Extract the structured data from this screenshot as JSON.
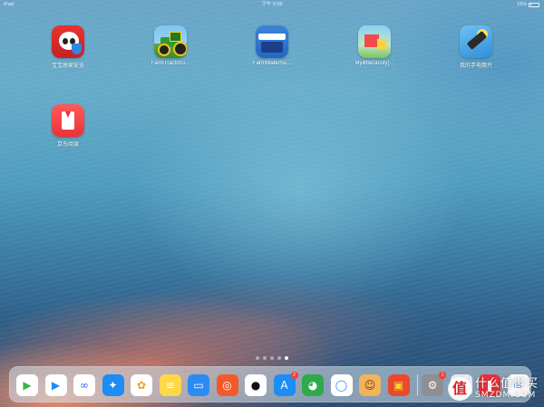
{
  "status_bar": {
    "device": "iPad",
    "time": "下午 5:09",
    "battery_text": "15%",
    "battery_level": 0.15
  },
  "home_apps": [
    {
      "label": "宝宝居家安全",
      "icon": "panda-safety-icon"
    },
    {
      "label": "FarmTractorG...",
      "icon": "tractor-icon"
    },
    {
      "label": "FarmWaterSu...",
      "icon": "water-truck-icon"
    },
    {
      "label": "Mylittlecarcity(...",
      "icon": "toy-city-icon"
    },
    {
      "label": "我的手电筒只",
      "icon": "flashlight-icon"
    },
    {
      "label": "京东阅读",
      "icon": "bookmark-icon"
    }
  ],
  "page_indicator": {
    "count": 5,
    "active_index": 4
  },
  "dock": {
    "apps": [
      {
        "name": "video-player-icon",
        "color": "#ffffff",
        "glyph": "▶",
        "glyph_color": "#3ab54a"
      },
      {
        "name": "video-app-icon",
        "color": "#ffffff",
        "glyph": "▶",
        "glyph_color": "#1c8cf0"
      },
      {
        "name": "cloud-drive-icon",
        "color": "#ffffff",
        "glyph": "∞",
        "glyph_color": "#2e6ff0"
      },
      {
        "name": "safari-icon",
        "color": "#1e8cf5",
        "glyph": "✦",
        "glyph_color": "#ffffff"
      },
      {
        "name": "photos-icon",
        "color": "#ffffff",
        "glyph": "✿",
        "glyph_color": "#f4a020"
      },
      {
        "name": "notes-icon",
        "color": "#ffd84a",
        "glyph": "≡",
        "glyph_color": "#ffffff"
      },
      {
        "name": "files-icon",
        "color": "#2a8cf0",
        "glyph": "▭",
        "glyph_color": "#ffffff"
      },
      {
        "name": "weibo-icon",
        "color": "#f25a2a",
        "glyph": "◎",
        "glyph_color": "#ffffff"
      },
      {
        "name": "qq-icon",
        "color": "#ffffff",
        "glyph": "●",
        "glyph_color": "#111111"
      },
      {
        "name": "app-store-icon",
        "color": "#1e8cf5",
        "glyph": "A",
        "glyph_color": "#ffffff",
        "badge": "2"
      },
      {
        "name": "panda-game-icon",
        "color": "#2faa4a",
        "glyph": "◕",
        "glyph_color": "#ffffff"
      },
      {
        "name": "search-app-icon",
        "color": "#ffffff",
        "glyph": "◯",
        "glyph_color": "#2a8cf0"
      },
      {
        "name": "kids-game-icon",
        "color": "#f2b35a",
        "glyph": "☺",
        "glyph_color": "#7a3c18"
      },
      {
        "name": "firetruck-game-icon",
        "color": "#e84a2a",
        "glyph": "▣",
        "glyph_color": "#ffd23a"
      },
      {
        "name": "settings-icon",
        "color": "#8e8e93",
        "glyph": "⚙",
        "glyph_color": "#ffffff",
        "badge": "1"
      },
      {
        "name": "mail-icon",
        "color": "#e8e8ee",
        "glyph": "✉",
        "glyph_color": "#2a8cf0"
      },
      {
        "name": "reader-icon",
        "color": "#e8333a",
        "glyph": "❚",
        "glyph_color": "#ffffff"
      },
      {
        "name": "messages-icon",
        "color": "#ffffff",
        "glyph": "✉",
        "glyph_color": "#2a8cf0"
      }
    ]
  },
  "watermark": {
    "badge": "值",
    "line1": "什么值得买",
    "line2": "SMZDM.COM"
  }
}
